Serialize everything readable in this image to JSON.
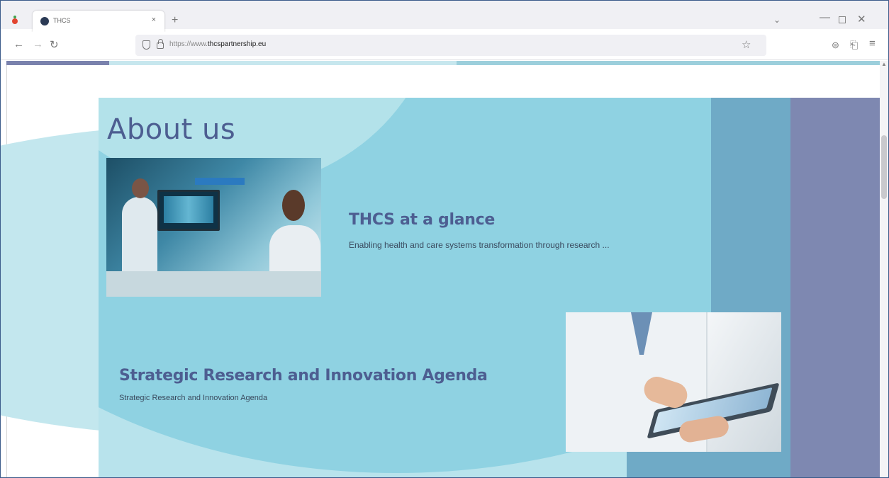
{
  "browser": {
    "tab_title": "THCS",
    "tab_close": "×",
    "new_tab": "+",
    "list_tabs": "⌄",
    "minimize": "—",
    "close": "✕",
    "url_prefix": "https://www.",
    "url_host": "thcspartnership.eu",
    "back": "←",
    "forward": "→",
    "reload": "↻",
    "star": "☆",
    "pocket": "⊜",
    "extensions": "⎗",
    "menu": "≡"
  },
  "page": {
    "title": "About us",
    "cards": [
      {
        "title": "THCS at a glance",
        "description": "Enabling health and care systems transformation through research ..."
      },
      {
        "title": "Strategic Research and Innovation Agenda",
        "description": "Strategic Research and Innovation Agenda"
      }
    ]
  },
  "colors": {
    "title": "#4d5e91",
    "section_bg": "#b8e3ec",
    "blob": "#8fd2e2",
    "steel_column": "#6faac6",
    "purple_column": "#7e88b1"
  }
}
